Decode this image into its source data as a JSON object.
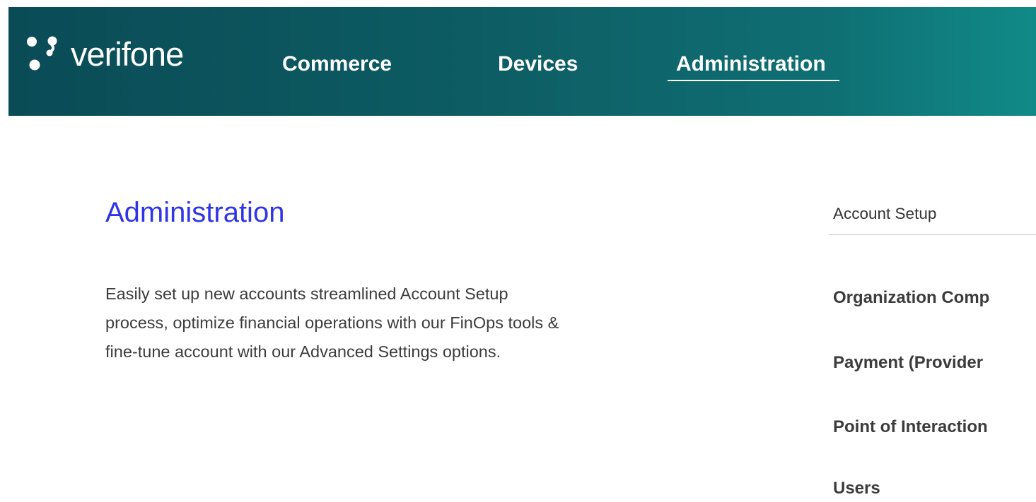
{
  "header": {
    "logo_text": "verifone",
    "nav_tabs": [
      {
        "label": "Commerce",
        "active": false
      },
      {
        "label": "Devices",
        "active": false
      },
      {
        "label": "Administration",
        "active": true
      }
    ]
  },
  "main": {
    "title": "Administration",
    "description_lines": [
      "Easily set up new accounts streamlined Account Setup",
      "process, optimize financial operations with our FinOps tools &",
      "fine-tune account with our Advanced Settings options."
    ]
  },
  "side_panel": {
    "heading": "Account Setup",
    "links": [
      {
        "label": "Organization Comp"
      },
      {
        "label": "Payment (Provider"
      },
      {
        "label": "Point of Interaction"
      },
      {
        "label": "Users"
      }
    ]
  },
  "colors": {
    "header_bg_start": "#0a4b56",
    "header_bg_end": "#108a88",
    "title_blue": "#2f35e6",
    "text_dark": "#3c3c3c"
  },
  "icons": {
    "logo_mark": "verifone-dots-logo-icon"
  }
}
